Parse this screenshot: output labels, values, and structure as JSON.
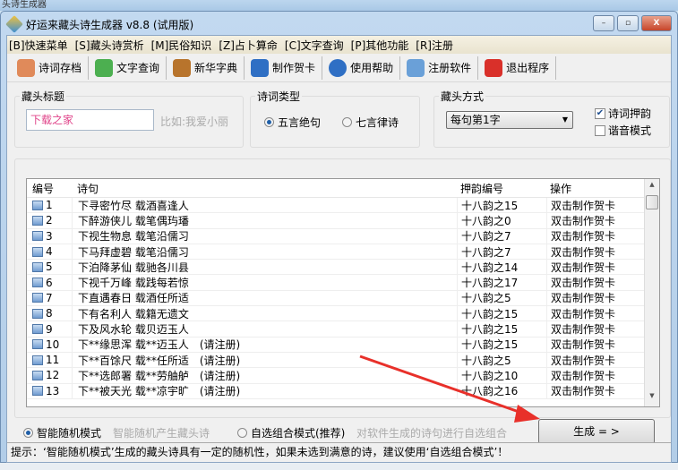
{
  "background_window": {
    "title": "头诗生成器"
  },
  "window": {
    "title": "好运来藏头诗生成器 v8.8 (试用版)",
    "minimize": "–",
    "maximize": "▫",
    "close": "X"
  },
  "menu": [
    "[B]快速菜单",
    "[S]藏头诗赏析",
    "[M]民俗知识",
    "[Z]占卜算命",
    "[C]文字查询",
    "[P]其他功能",
    "[R]注册"
  ],
  "toolbar": [
    {
      "label": "诗词存档",
      "icon": "users-icon",
      "color": "#e08a5a"
    },
    {
      "label": "文字查询",
      "icon": "refresh-icon",
      "color": "#4caf50"
    },
    {
      "label": "新华字典",
      "icon": "graduate-icon",
      "color": "#b8742c"
    },
    {
      "label": "制作贺卡",
      "icon": "redo-arrow-icon",
      "color": "#2f6fc4"
    },
    {
      "label": "使用帮助",
      "icon": "help-icon",
      "color": "#2f6fc4"
    },
    {
      "label": "注册软件",
      "icon": "monitor-icon",
      "color": "#6aa0d8"
    },
    {
      "label": "退出程序",
      "icon": "close-x-icon",
      "color": "#d9302a"
    }
  ],
  "title_group": {
    "label": "藏头标题",
    "value": "下载之家",
    "hint": "比如:我爱小丽"
  },
  "type_group": {
    "label": "诗词类型",
    "options": [
      "五言绝句",
      "七言律诗"
    ],
    "selected": "五言绝句"
  },
  "mode_group": {
    "label": "藏头方式",
    "select_value": "每句第1字",
    "rhyme_label": "诗词押韵",
    "rhyme_checked": true,
    "homophone_label": "谐音模式",
    "homophone_checked": false
  },
  "table": {
    "headers": [
      "编号",
      "诗句",
      "押韵编号",
      "操作"
    ],
    "rows": [
      [
        "1",
        "下寻密竹尽 载酒喜逢人",
        "十八韵之15",
        "双击制作贺卡"
      ],
      [
        "2",
        "下醉游侠儿 载笔偶玙璠",
        "十八韵之0",
        "双击制作贺卡"
      ],
      [
        "3",
        "下视生物息 载笔沿儒习",
        "十八韵之7",
        "双击制作贺卡"
      ],
      [
        "4",
        "下马拜虚碧 载笔沿儒习",
        "十八韵之7",
        "双击制作贺卡"
      ],
      [
        "5",
        "下泊降茅仙 载驰各川县",
        "十八韵之14",
        "双击制作贺卡"
      ],
      [
        "6",
        "下视千万峰 载践每若惊",
        "十八韵之17",
        "双击制作贺卡"
      ],
      [
        "7",
        "下直遇春日 载酒任所适",
        "十八韵之5",
        "双击制作贺卡"
      ],
      [
        "8",
        "下有名利人 载籍无遗文",
        "十八韵之15",
        "双击制作贺卡"
      ],
      [
        "9",
        "下及风水轮 载贝迈玉人",
        "十八韵之15",
        "双击制作贺卡"
      ],
      [
        "10",
        "下**缘思浑 载**迈玉人　(请注册)",
        "十八韵之15",
        "双击制作贺卡"
      ],
      [
        "11",
        "下**百馀尺 载**任所适　(请注册)",
        "十八韵之5",
        "双击制作贺卡"
      ],
      [
        "12",
        "下**选郎署 载**劳舳舻　(请注册)",
        "十八韵之10",
        "双击制作贺卡"
      ],
      [
        "13",
        "下**被天光 载**凉宇旷　(请注册)",
        "十八韵之16",
        "双击制作贺卡"
      ]
    ]
  },
  "bottom": {
    "mode1": "智能随机模式",
    "mode1_desc": "智能随机产生藏头诗",
    "mode2": "自选组合模式(推荐)",
    "mode2_desc": "对软件生成的诗句进行自选组合",
    "selected": "智能随机模式",
    "generate": "生成 = >"
  },
  "status": "提示：‘智能随机模式’生成的藏头诗具有一定的随机性，如果未选到满意的诗，建议使用‘自选组合模式’！",
  "annotation_color": "#e8302a"
}
